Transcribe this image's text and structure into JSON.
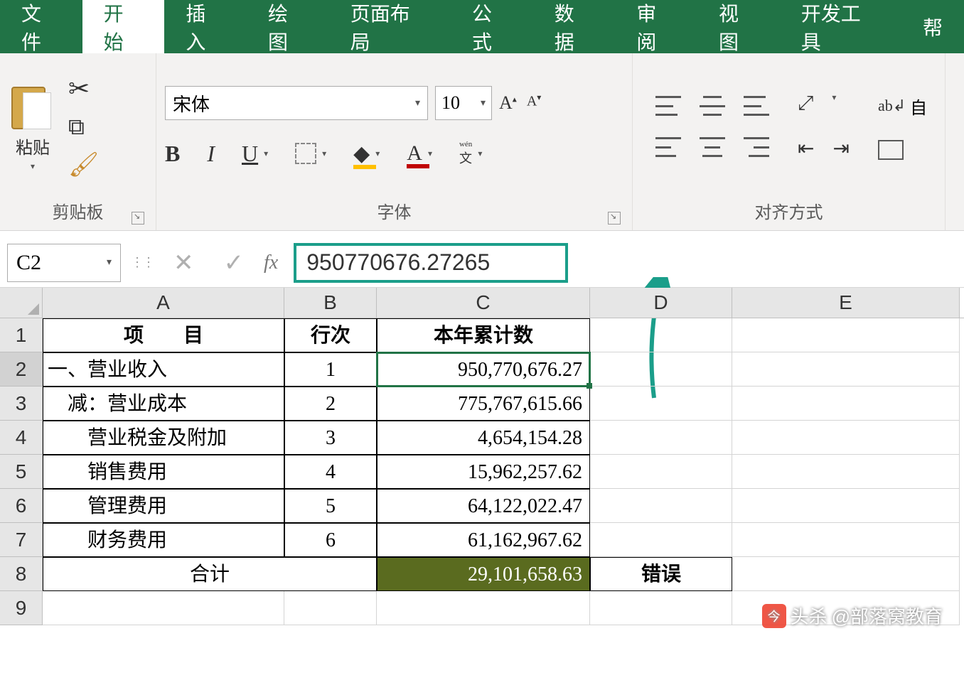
{
  "ribbon": {
    "tabs": [
      "文件",
      "开始",
      "插入",
      "绘图",
      "页面布局",
      "公式",
      "数据",
      "审阅",
      "视图",
      "开发工具",
      "帮"
    ],
    "active_index": 1,
    "clipboard": {
      "paste": "粘贴",
      "group_label": "剪贴板"
    },
    "font": {
      "name": "宋体",
      "size": "10",
      "grow": "A",
      "shrink": "A",
      "bold": "B",
      "italic": "I",
      "underline": "U",
      "fill_glyph": "◆",
      "color_glyph": "A",
      "phonetic_top": "wén",
      "phonetic_main": "文",
      "group_label": "字体"
    },
    "alignment": {
      "wrap_label": "自",
      "group_label": "对齐方式"
    }
  },
  "formula_bar": {
    "name_box": "C2",
    "fx": "fx",
    "value": "950770676.27265"
  },
  "columns": [
    "A",
    "B",
    "C",
    "D",
    "E"
  ],
  "rows": [
    {
      "n": "1",
      "A": "项　　目",
      "B": "行次",
      "C": "本年累计数",
      "D": "",
      "E": "",
      "header": true
    },
    {
      "n": "2",
      "A": "一、营业收入",
      "B": "1",
      "C": "950,770,676.27",
      "D": "",
      "E": "",
      "selected": true
    },
    {
      "n": "3",
      "A": "　减：营业成本",
      "B": "2",
      "C": "775,767,615.66",
      "D": "",
      "E": ""
    },
    {
      "n": "4",
      "A": "　　营业税金及附加",
      "B": "3",
      "C": "4,654,154.28",
      "D": "",
      "E": ""
    },
    {
      "n": "5",
      "A": "　　销售费用",
      "B": "4",
      "C": "15,962,257.62",
      "D": "",
      "E": ""
    },
    {
      "n": "6",
      "A": "　　管理费用",
      "B": "5",
      "C": "64,122,022.47",
      "D": "",
      "E": ""
    },
    {
      "n": "7",
      "A": "　　财务费用",
      "B": "6",
      "C": "61,162,967.62",
      "D": "",
      "E": ""
    },
    {
      "n": "8",
      "AB": "合计",
      "C": "29,101,658.63",
      "D": "错误",
      "E": "",
      "total": true
    },
    {
      "n": "9",
      "A": "",
      "B": "",
      "C": "",
      "D": "",
      "E": ""
    }
  ],
  "watermark": {
    "prefix": "头杀",
    "text": "@部落窝教育"
  }
}
